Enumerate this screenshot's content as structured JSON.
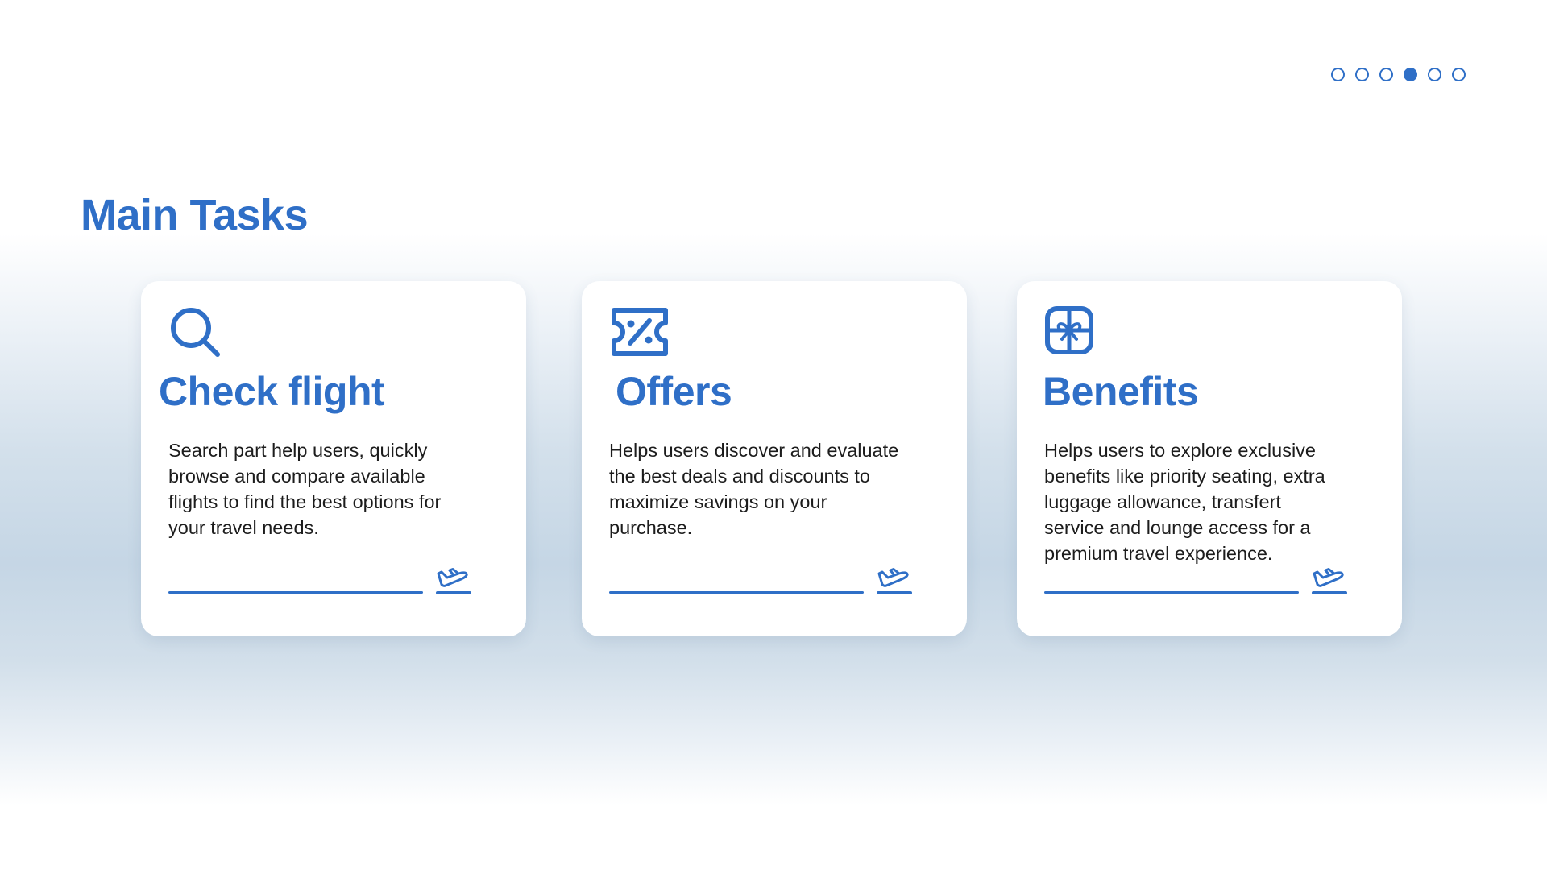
{
  "pager": {
    "total": 6,
    "active_index": 4
  },
  "page_title": "Main Tasks",
  "cards": [
    {
      "title": "Check flight",
      "description": "Search part help users, quickly browse and compare available flights to find the best options for your travel needs.",
      "icon": "search-icon",
      "action_icon": "airplane-takeoff-icon"
    },
    {
      "title": "Offers",
      "description": "Helps users discover and evaluate the best deals and discounts to maximize savings on your purchase.",
      "icon": "discount-ticket-icon",
      "action_icon": "airplane-takeoff-icon"
    },
    {
      "title": "Benefits",
      "description": "Helps users to explore exclusive benefits like priority seating, extra luggage allowance, transfert service and lounge access for a premium travel experience.",
      "icon": "gift-icon",
      "action_icon": "airplane-takeoff-icon"
    }
  ],
  "colors": {
    "accent": "#2f6fc7",
    "text": "#1c1c1c",
    "card_bg": "#ffffff"
  }
}
